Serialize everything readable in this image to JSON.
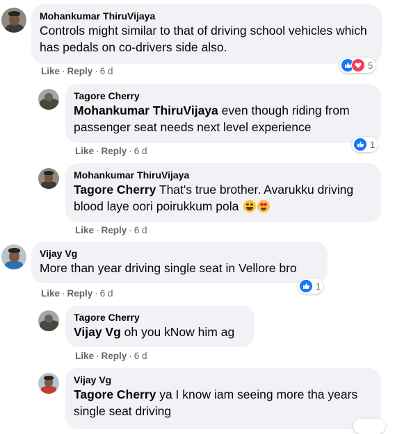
{
  "actions": {
    "like": "Like",
    "reply": "Reply",
    "separator": "·"
  },
  "comments": [
    {
      "author": "Mohankumar ThiruVijaya",
      "mention": "",
      "text": "Controls might similar to that of driving school vehicles which has pedals on co-drivers side also.",
      "time": "6 d",
      "reaction_count": "5",
      "reactions": [
        "like-icon",
        "love-icon"
      ]
    },
    {
      "author": "Tagore Cherry",
      "mention": "Mohankumar ThiruVijaya",
      "text": " even though riding from passenger seat needs next level experience",
      "time": "6 d",
      "reaction_count": "1",
      "reactions": [
        "like-icon"
      ]
    },
    {
      "author": "Mohankumar ThiruVijaya",
      "mention": "Tagore Cherry",
      "text": " That's true brother. Avarukku driving blood laye oori poirukkum pola ",
      "time": "6 d",
      "emojis": [
        "grinning-sweat-emoji",
        "heart-eyes-emoji"
      ]
    },
    {
      "author": "Vijay Vg",
      "mention": "",
      "text": "More than year driving single seat in Vellore bro",
      "time": "6 d",
      "reaction_count": "1",
      "reactions": [
        "like-icon"
      ]
    },
    {
      "author": "Tagore Cherry",
      "mention": "Vijay Vg",
      "text": " oh you kNow him ag",
      "time": "6 d"
    },
    {
      "author": "Vijay Vg",
      "mention": "Tagore Cherry",
      "text": " ya I know iam seeing more tha years single seat driving",
      "time": ""
    }
  ],
  "colors": {
    "bubble": "#f0f2f5",
    "meta": "#65676b",
    "like": "#1877f2",
    "love": "#f33e58"
  }
}
